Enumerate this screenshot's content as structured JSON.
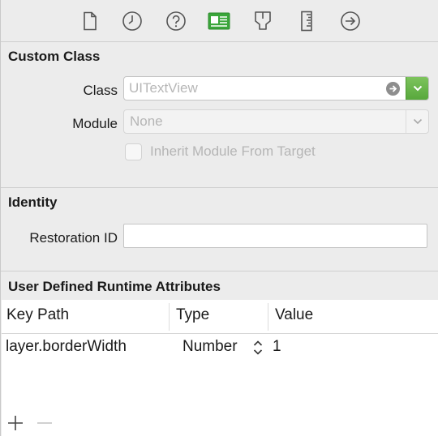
{
  "toolbar": {
    "icons": [
      {
        "name": "file-inspector-icon"
      },
      {
        "name": "quick-help-icon"
      },
      {
        "name": "help-icon"
      },
      {
        "name": "identity-inspector-icon"
      },
      {
        "name": "attributes-inspector-icon"
      },
      {
        "name": "size-inspector-icon"
      },
      {
        "name": "connections-inspector-icon"
      }
    ],
    "active_color": "#3aa63a"
  },
  "custom_class": {
    "title": "Custom Class",
    "class_label": "Class",
    "class_placeholder": "UITextView",
    "module_label": "Module",
    "module_value": "None",
    "inherit_label": "Inherit Module From Target"
  },
  "identity": {
    "title": "Identity",
    "restoration_label": "Restoration ID",
    "restoration_value": ""
  },
  "runtime_attributes": {
    "title": "User Defined Runtime Attributes",
    "columns": [
      "Key Path",
      "Type",
      "Value"
    ],
    "rows": [
      {
        "key_path": "layer.borderWidth",
        "type": "Number",
        "value": "1"
      }
    ]
  }
}
